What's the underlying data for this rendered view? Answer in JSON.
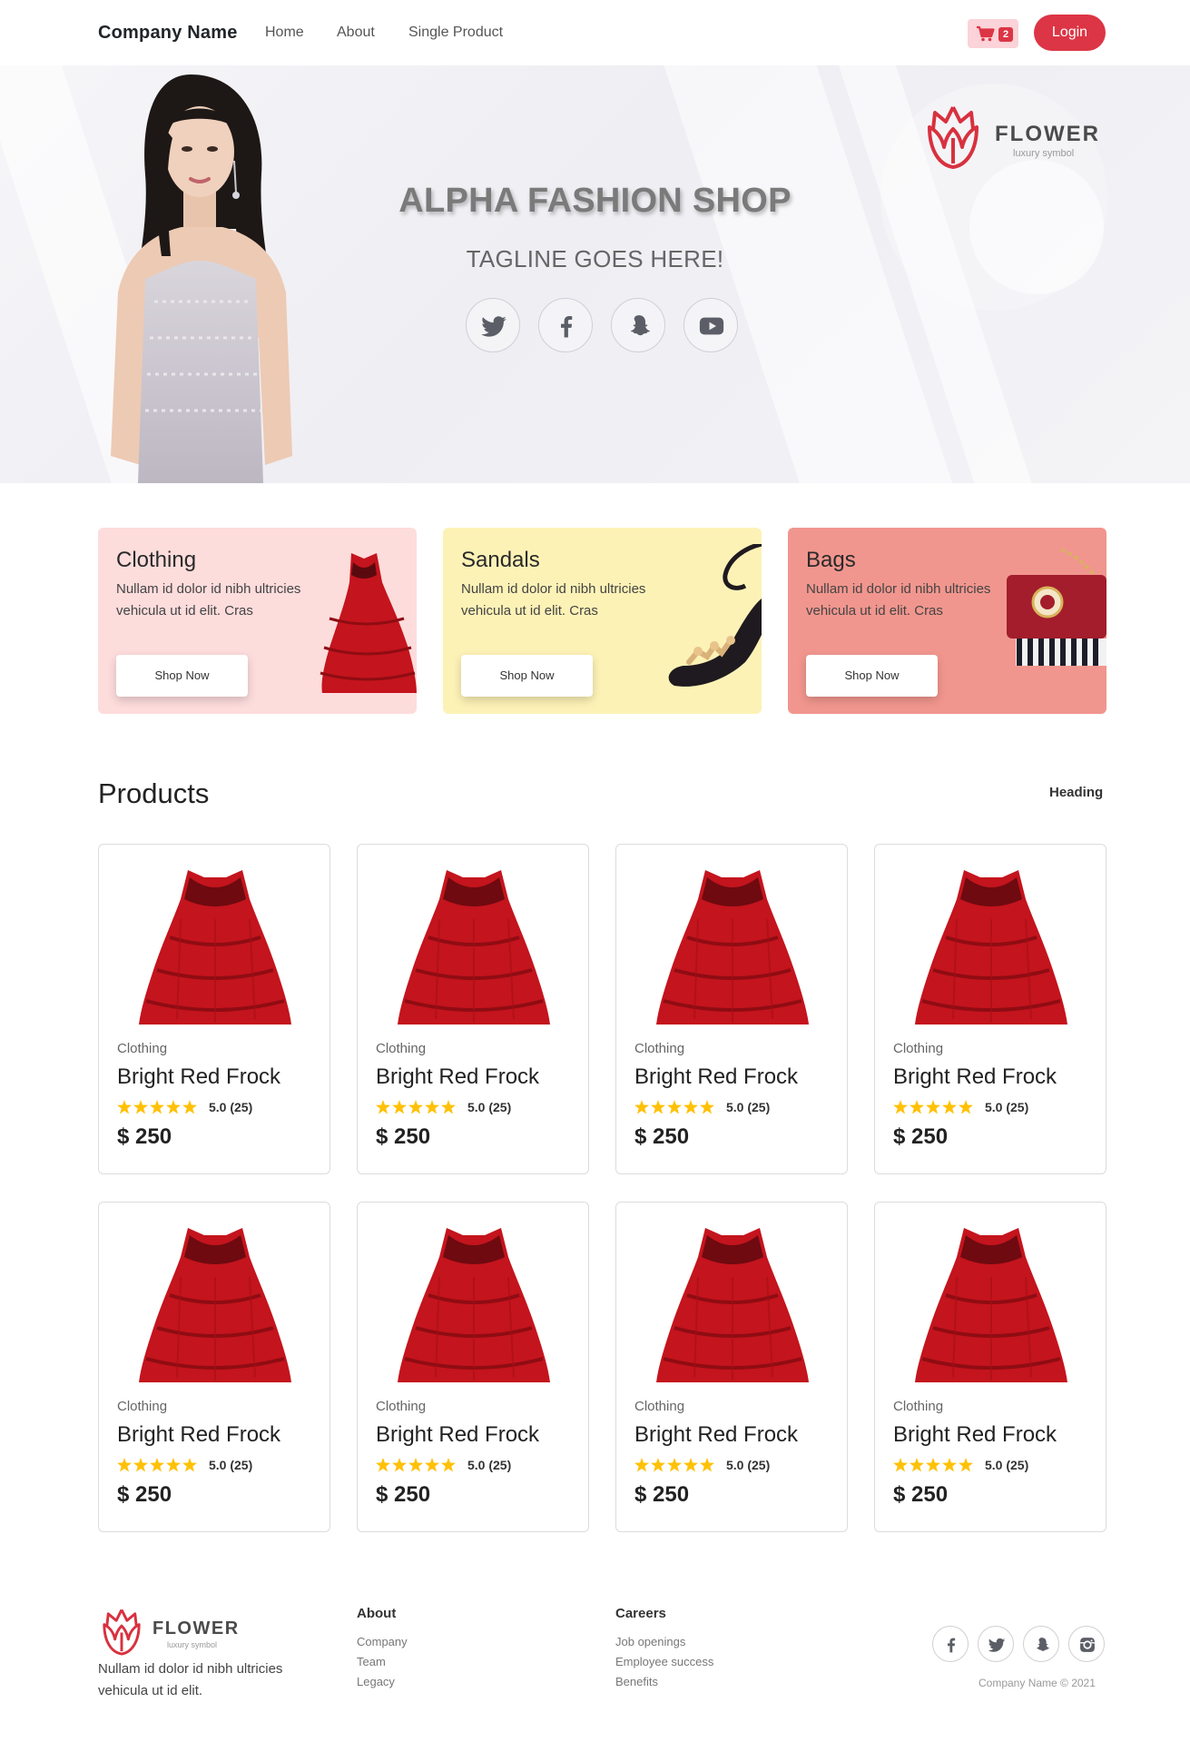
{
  "nav": {
    "brand": "Company Name",
    "links": [
      "Home",
      "About",
      "Single Product"
    ],
    "cart_count": "2",
    "login_label": "Login"
  },
  "hero": {
    "title": "ALPHA FASHION SHOP",
    "tagline": "TAGLINE GOES HERE!",
    "logo_word": "FLOWER",
    "logo_sub": "luxury symbol",
    "social_icons": [
      "twitter-icon",
      "facebook-icon",
      "snapchat-icon",
      "youtube-icon"
    ]
  },
  "categories": [
    {
      "title": "Clothing",
      "desc": "Nullam id dolor id nibh ultricies vehicula ut id elit. Cras",
      "button": "Shop Now",
      "color": "#fddcdc"
    },
    {
      "title": "Sandals",
      "desc": "Nullam id dolor id nibh ultricies vehicula ut id elit. Cras",
      "button": "Shop Now",
      "color": "#fdf2b6"
    },
    {
      "title": "Bags",
      "desc": "Nullam id dolor id nibh ultricies vehicula ut id elit. Cras",
      "button": "Shop Now",
      "color": "#f1968e"
    }
  ],
  "products_section": {
    "title": "Products",
    "link": "Heading"
  },
  "products": [
    {
      "category": "Clothing",
      "name": "Bright Red Frock",
      "rating": "5.0 (25)",
      "price": "$ 250"
    },
    {
      "category": "Clothing",
      "name": "Bright Red Frock",
      "rating": "5.0 (25)",
      "price": "$ 250"
    },
    {
      "category": "Clothing",
      "name": "Bright Red Frock",
      "rating": "5.0 (25)",
      "price": "$ 250"
    },
    {
      "category": "Clothing",
      "name": "Bright Red Frock",
      "rating": "5.0 (25)",
      "price": "$ 250"
    },
    {
      "category": "Clothing",
      "name": "Bright Red Frock",
      "rating": "5.0 (25)",
      "price": "$ 250"
    },
    {
      "category": "Clothing",
      "name": "Bright Red Frock",
      "rating": "5.0 (25)",
      "price": "$ 250"
    },
    {
      "category": "Clothing",
      "name": "Bright Red Frock",
      "rating": "5.0 (25)",
      "price": "$ 250"
    },
    {
      "category": "Clothing",
      "name": "Bright Red Frock",
      "rating": "5.0 (25)",
      "price": "$ 250"
    }
  ],
  "footer": {
    "logo_word": "FLOWER",
    "logo_sub": "luxury symbol",
    "desc": "Nullam id dolor id nibh ultricies vehicula ut id elit.",
    "columns": [
      {
        "heading": "About",
        "links": [
          "Company",
          "Team",
          "Legacy"
        ]
      },
      {
        "heading": "Careers",
        "links": [
          "Job openings",
          "Employee success",
          "Benefits"
        ]
      }
    ],
    "social_icons": [
      "facebook-icon",
      "twitter-icon",
      "snapchat-icon",
      "instagram-icon"
    ],
    "copyright": "Company Name © 2021"
  },
  "colors": {
    "accent": "#dc3545",
    "star": "#ffc107",
    "dress": "#c4141d"
  }
}
